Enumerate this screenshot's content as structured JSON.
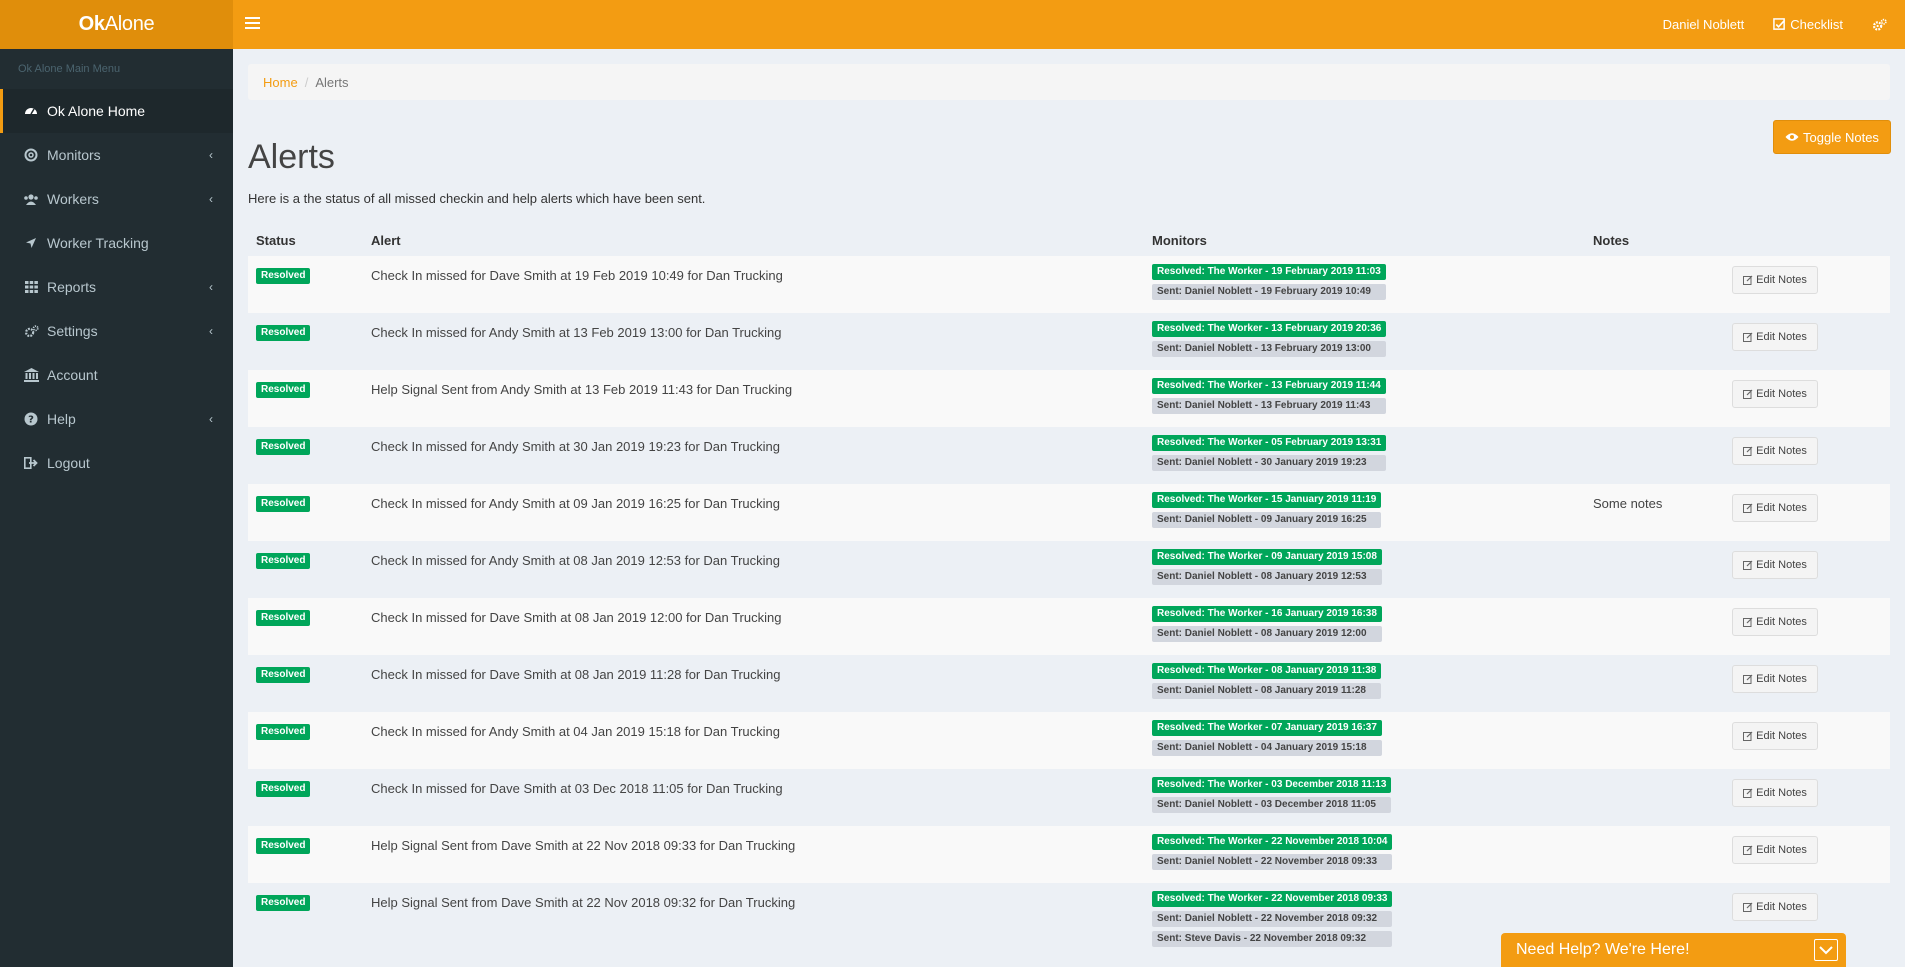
{
  "app": {
    "logo_bold": "Ok",
    "logo_rest": "Alone"
  },
  "topbar": {
    "user_name": "Daniel Noblett",
    "checklist_label": "Checklist"
  },
  "sidebar": {
    "header": "Ok Alone Main Menu",
    "items": [
      {
        "label": "Ok Alone Home",
        "icon": "dashboard-icon"
      },
      {
        "label": "Monitors",
        "icon": "life-ring-icon"
      },
      {
        "label": "Workers",
        "icon": "users-icon"
      },
      {
        "label": "Worker Tracking",
        "icon": "location-arrow-icon"
      },
      {
        "label": "Reports",
        "icon": "grid-icon"
      },
      {
        "label": "Settings",
        "icon": "cogs-icon"
      },
      {
        "label": "Account",
        "icon": "bank-icon"
      },
      {
        "label": "Help",
        "icon": "question-circle-icon"
      },
      {
        "label": "Logout",
        "icon": "sign-out-icon"
      }
    ]
  },
  "breadcrumb": {
    "home": "Home",
    "current": "Alerts"
  },
  "page": {
    "title": "Alerts",
    "description": "Here is a the status of all missed checkin and help alerts which have been sent.",
    "toggle_notes": "Toggle Notes"
  },
  "table": {
    "headers": {
      "status": "Status",
      "alert": "Alert",
      "monitors": "Monitors",
      "notes": "Notes"
    },
    "edit_label": "Edit Notes",
    "rows": [
      {
        "status": "Resolved",
        "alert": "Check In missed for Dave Smith at 19 Feb 2019 10:49 for Dan Trucking",
        "resolved": "Resolved: The Worker - 19 February 2019 11:03",
        "sent": [
          "Sent: Daniel Noblett - 19 February 2019 10:49"
        ],
        "notes": ""
      },
      {
        "status": "Resolved",
        "alert": "Check In missed for Andy Smith at 13 Feb 2019 13:00 for Dan Trucking",
        "resolved": "Resolved: The Worker - 13 February 2019 20:36",
        "sent": [
          "Sent: Daniel Noblett - 13 February 2019 13:00"
        ],
        "notes": ""
      },
      {
        "status": "Resolved",
        "alert": "Help Signal Sent from Andy Smith at 13 Feb 2019 11:43 for Dan Trucking",
        "resolved": "Resolved: The Worker - 13 February 2019 11:44",
        "sent": [
          "Sent: Daniel Noblett - 13 February 2019 11:43"
        ],
        "notes": ""
      },
      {
        "status": "Resolved",
        "alert": "Check In missed for Andy Smith at 30 Jan 2019 19:23 for Dan Trucking",
        "resolved": "Resolved: The Worker - 05 February 2019 13:31",
        "sent": [
          "Sent: Daniel Noblett - 30 January 2019 19:23"
        ],
        "notes": ""
      },
      {
        "status": "Resolved",
        "alert": "Check In missed for Andy Smith at 09 Jan 2019 16:25 for Dan Trucking",
        "resolved": "Resolved: The Worker - 15 January 2019 11:19",
        "sent": [
          "Sent: Daniel Noblett - 09 January 2019 16:25"
        ],
        "notes": "Some notes"
      },
      {
        "status": "Resolved",
        "alert": "Check In missed for Andy Smith at 08 Jan 2019 12:53 for Dan Trucking",
        "resolved": "Resolved: The Worker - 09 January 2019 15:08",
        "sent": [
          "Sent: Daniel Noblett - 08 January 2019 12:53"
        ],
        "notes": ""
      },
      {
        "status": "Resolved",
        "alert": "Check In missed for Dave Smith at 08 Jan 2019 12:00 for Dan Trucking",
        "resolved": "Resolved: The Worker - 16 January 2019 16:38",
        "sent": [
          "Sent: Daniel Noblett - 08 January 2019 12:00"
        ],
        "notes": ""
      },
      {
        "status": "Resolved",
        "alert": "Check In missed for Dave Smith at 08 Jan 2019 11:28 for Dan Trucking",
        "resolved": "Resolved: The Worker - 08 January 2019 11:38",
        "sent": [
          "Sent: Daniel Noblett - 08 January 2019 11:28"
        ],
        "notes": ""
      },
      {
        "status": "Resolved",
        "alert": "Check In missed for Andy Smith at 04 Jan 2019 15:18 for Dan Trucking",
        "resolved": "Resolved: The Worker - 07 January 2019 16:37",
        "sent": [
          "Sent: Daniel Noblett - 04 January 2019 15:18"
        ],
        "notes": ""
      },
      {
        "status": "Resolved",
        "alert": "Check In missed for Dave Smith at 03 Dec 2018 11:05 for Dan Trucking",
        "resolved": "Resolved: The Worker - 03 December 2018 11:13",
        "sent": [
          "Sent: Daniel Noblett - 03 December 2018 11:05"
        ],
        "notes": ""
      },
      {
        "status": "Resolved",
        "alert": "Help Signal Sent from Dave Smith at 22 Nov 2018 09:33 for Dan Trucking",
        "resolved": "Resolved: The Worker - 22 November 2018 10:04",
        "sent": [
          "Sent: Daniel Noblett - 22 November 2018 09:33"
        ],
        "notes": ""
      },
      {
        "status": "Resolved",
        "alert": "Help Signal Sent from Dave Smith at 22 Nov 2018 09:32 for Dan Trucking",
        "resolved": "Resolved: The Worker - 22 November 2018 09:33",
        "sent": [
          "Sent: Daniel Noblett - 22 November 2018 09:32",
          "Sent: Steve Davis - 22 November 2018 09:32"
        ],
        "notes": ""
      }
    ]
  },
  "help_widget": {
    "label": "Need Help? We're Here!"
  },
  "colors": {
    "brand": "#f39c12",
    "brand_dark": "#e08e0b",
    "sidebar": "#222d32",
    "success": "#00a65a"
  }
}
